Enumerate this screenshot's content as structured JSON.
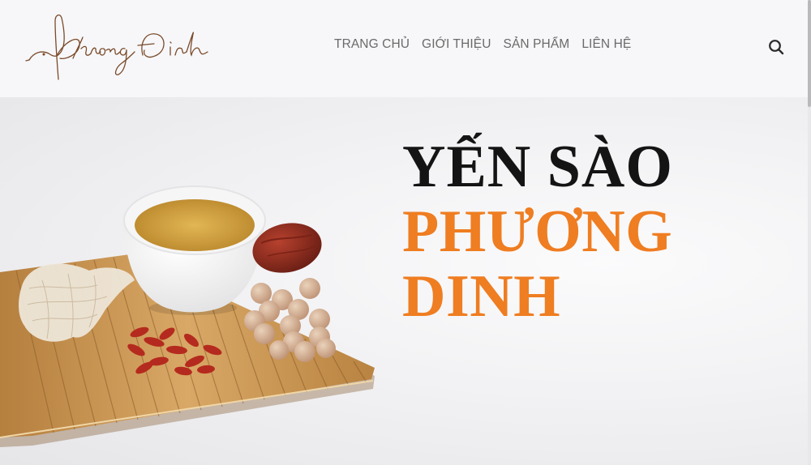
{
  "brand": {
    "logo_text": "Phuong Dinh",
    "colors": {
      "logo": "#7a4a2a",
      "accent": "#ef7d21",
      "dark": "#141414"
    }
  },
  "nav": {
    "items": [
      {
        "label": "TRANG CHỦ"
      },
      {
        "label": "GIỚI THIỆU"
      },
      {
        "label": "SẢN PHẨM"
      },
      {
        "label": "LIÊN HỆ"
      }
    ]
  },
  "header": {
    "search_icon": "search-icon"
  },
  "hero": {
    "title_line1": "YẾN SÀO",
    "title_line2": "PHƯƠNG",
    "title_line3": "DINH",
    "image": "bird-nest-tea-cup-on-bamboo-mat"
  }
}
